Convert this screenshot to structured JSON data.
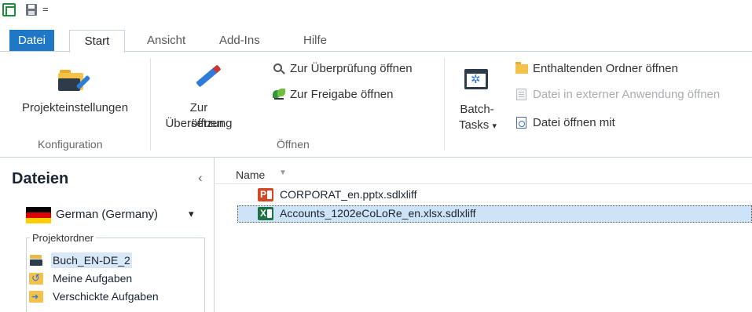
{
  "quick_access": {
    "more_label": "="
  },
  "tabs": [
    {
      "label": "Datei"
    },
    {
      "label": "Start"
    },
    {
      "label": "Ansicht"
    },
    {
      "label": "Add-Ins"
    },
    {
      "label": "Hilfe"
    }
  ],
  "ribbon": {
    "konfiguration": {
      "group_label": "Konfiguration",
      "project_settings_label": "Projekteinstellungen"
    },
    "oeffnen": {
      "group_label": "Öffnen",
      "translate_line1": "Zur Übersetzung",
      "translate_line2": "öffnen",
      "review_label": "Zur Überprüfung öffnen",
      "signoff_label": "Zur Freigabe öffnen"
    },
    "batch": {
      "line1": "Batch-",
      "line2": "Tasks",
      "arrow": "▾"
    },
    "file_actions": {
      "open_folder": "Enthaltenden Ordner öffnen",
      "open_external": "Datei in externer Anwendung öffnen",
      "open_with": "Datei öffnen mit"
    }
  },
  "left_panel": {
    "title": "Dateien",
    "collapse": "‹",
    "language": "German (Germany)",
    "language_arrow": "▾",
    "project_folder_label": "Projektordner",
    "items": [
      {
        "label": "Buch_EN-DE_2",
        "icon": "project-icon",
        "selected": true
      },
      {
        "label": "Meine Aufgaben",
        "icon": "my-tasks-icon",
        "selected": false
      },
      {
        "label": "Verschickte Aufgaben",
        "icon": "sent-tasks-icon",
        "selected": false
      }
    ]
  },
  "file_list": {
    "column_name": "Name",
    "sort_glyph": "▼",
    "files": [
      {
        "name": "CORPORAT_en.pptx.sdlxliff",
        "type_letter": "P",
        "icon": "powerpoint-icon",
        "selected": false
      },
      {
        "name": "Accounts_1202eCoLoRe_en.xlsx.sdlxliff",
        "type_letter": "X",
        "icon": "excel-icon",
        "selected": true
      }
    ]
  },
  "colors": {
    "accent": "#1f77c6",
    "selection": "#cde3f7"
  }
}
